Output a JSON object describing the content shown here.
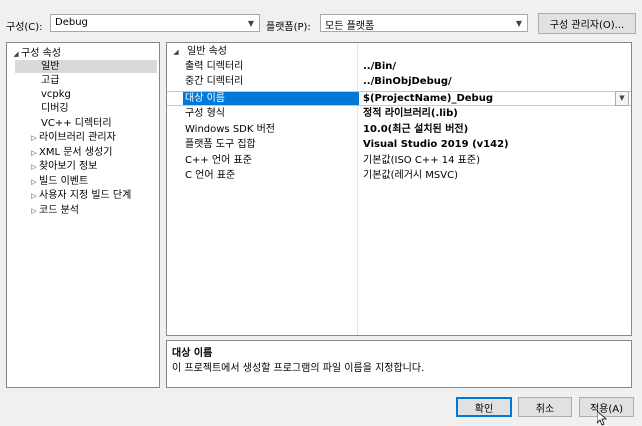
{
  "toolbar": {
    "config_label": "구성(C):",
    "config_value": "Debug",
    "platform_label": "플랫폼(P):",
    "platform_value": "모든 플랫폼",
    "config_manager": "구성 관리자(O)..."
  },
  "tree": {
    "root": "구성 속성",
    "items": [
      {
        "label": "일반",
        "expandable": false,
        "selected": true
      },
      {
        "label": "고급",
        "expandable": false
      },
      {
        "label": "vcpkg",
        "expandable": false
      },
      {
        "label": "디버깅",
        "expandable": false
      },
      {
        "label": "VC++ 디렉터리",
        "expandable": false
      },
      {
        "label": "라이브러리 관리자",
        "expandable": true
      },
      {
        "label": "XML 문서 생성기",
        "expandable": true
      },
      {
        "label": "찾아보기 정보",
        "expandable": true
      },
      {
        "label": "빌드 이벤트",
        "expandable": true
      },
      {
        "label": "사용자 지정 빌드 단계",
        "expandable": true
      },
      {
        "label": "코드 분석",
        "expandable": true
      }
    ]
  },
  "grid": {
    "section": "일반 속성",
    "rows": [
      {
        "name": "출력 디렉터리",
        "value": "../Bin/",
        "bold": true
      },
      {
        "name": "중간 디렉터리",
        "value": "../BinObjDebug/",
        "bold": true
      },
      {
        "name": "대상 이름",
        "value": "$(ProjectName)_Debug",
        "bold": true,
        "selected": true
      },
      {
        "name": "구성 형식",
        "value": "정적 라이브러리(.lib)",
        "bold": true
      },
      {
        "name": "Windows SDK 버전",
        "value": "10.0(최근 설치된 버전)",
        "bold": true
      },
      {
        "name": "플랫폼 도구 집합",
        "value": "Visual Studio 2019 (v142)",
        "bold": true
      },
      {
        "name": "C++ 언어 표준",
        "value": "기본값(ISO C++ 14 표준)",
        "bold": false
      },
      {
        "name": "C 언어 표준",
        "value": "기본값(레거시 MSVC)",
        "bold": false
      }
    ]
  },
  "description": {
    "title": "대상 이름",
    "text": "이 프로젝트에서 생성할 프로그램의 파일 이름을 지정합니다."
  },
  "buttons": {
    "ok": "확인",
    "cancel": "취소",
    "apply": "적용(A)"
  }
}
